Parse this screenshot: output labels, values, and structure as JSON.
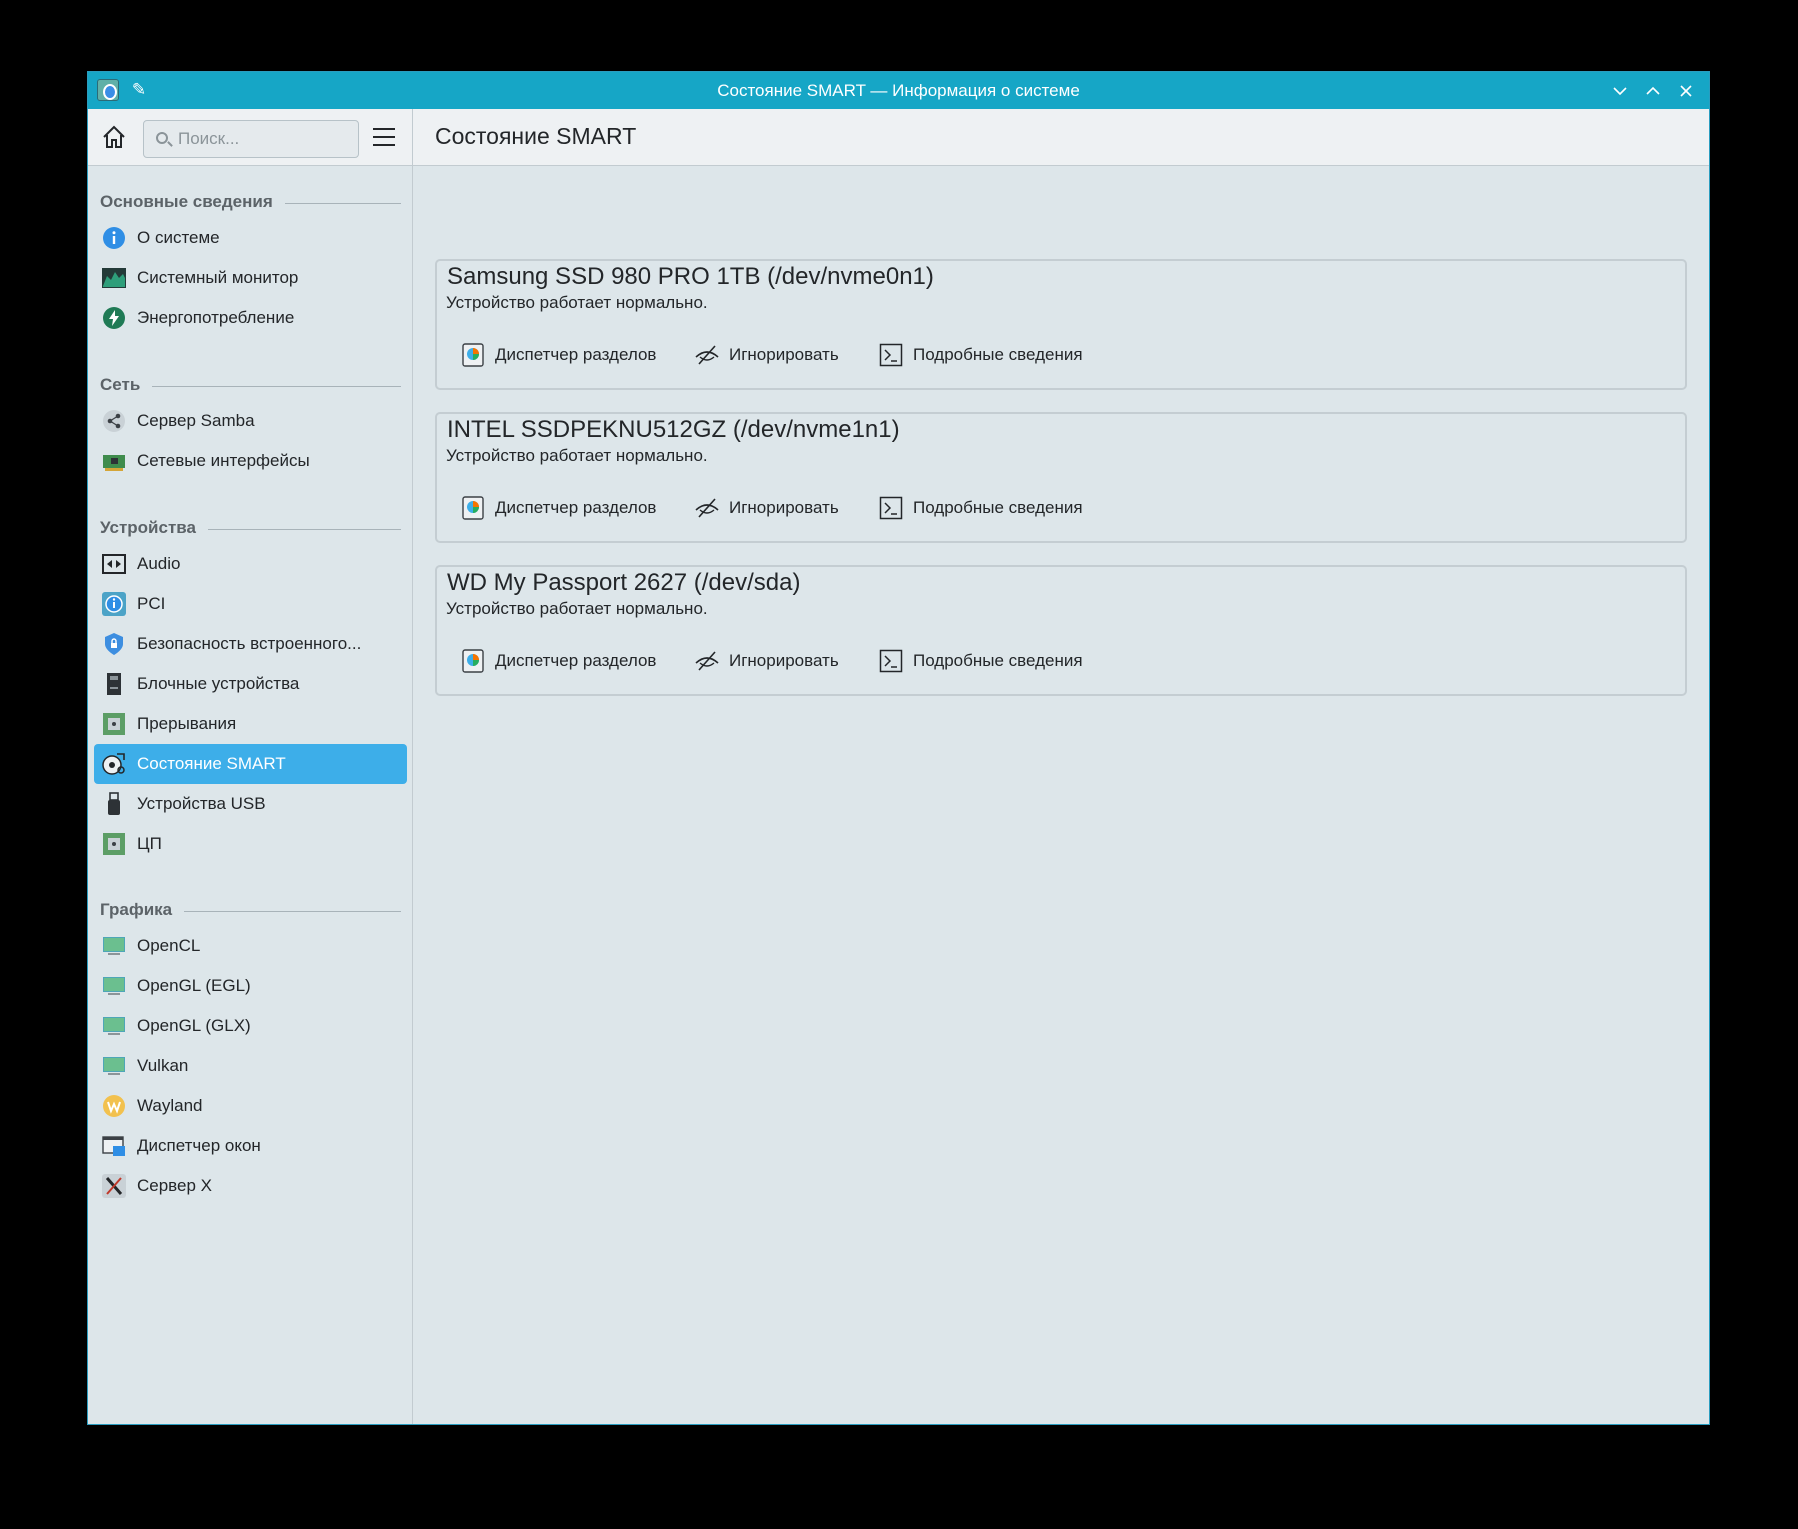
{
  "window": {
    "title": "Состояние SMART — Информация о системе"
  },
  "toolbar": {
    "search_placeholder": "Поиск...",
    "page_title": "Состояние SMART"
  },
  "sidebar": {
    "sections": [
      {
        "label": "Основные сведения"
      },
      {
        "label": "Сеть"
      },
      {
        "label": "Устройства"
      },
      {
        "label": "Графика"
      }
    ],
    "items": [
      {
        "label": "О системе",
        "icon": "info-icon"
      },
      {
        "label": "Системный монитор",
        "icon": "system-monitor-icon"
      },
      {
        "label": "Энергопотребление",
        "icon": "energy-icon"
      },
      {
        "label": "Сервер Samba",
        "icon": "samba-icon"
      },
      {
        "label": "Сетевые интерфейсы",
        "icon": "network-card-icon"
      },
      {
        "label": "Audio",
        "icon": "audio-icon"
      },
      {
        "label": "PCI",
        "icon": "pci-icon"
      },
      {
        "label": "Безопасность встроенного...",
        "icon": "firmware-security-icon"
      },
      {
        "label": "Блочные устройства",
        "icon": "block-device-icon"
      },
      {
        "label": "Прерывания",
        "icon": "interrupts-icon"
      },
      {
        "label": "Состояние SMART",
        "icon": "smart-status-icon",
        "active": true
      },
      {
        "label": "Устройства USB",
        "icon": "usb-icon"
      },
      {
        "label": "ЦП",
        "icon": "cpu-icon"
      },
      {
        "label": "OpenCL",
        "icon": "display-icon"
      },
      {
        "label": "OpenGL (EGL)",
        "icon": "display-icon"
      },
      {
        "label": "OpenGL (GLX)",
        "icon": "display-icon"
      },
      {
        "label": "Vulkan",
        "icon": "display-icon"
      },
      {
        "label": "Wayland",
        "icon": "wayland-icon"
      },
      {
        "label": "Диспетчер окон",
        "icon": "window-manager-icon"
      },
      {
        "label": "Сервер X",
        "icon": "x-server-icon"
      }
    ]
  },
  "disks": [
    {
      "name": "Samsung SSD 980 PRO 1TB (/dev/nvme0n1)",
      "status": "Устройство работает нормально."
    },
    {
      "name": "INTEL SSDPEKNU512GZ (/dev/nvme1n1)",
      "status": "Устройство работает нормально."
    },
    {
      "name": "WD My Passport 2627 (/dev/sda)",
      "status": "Устройство работает нормально."
    }
  ],
  "card_actions": {
    "partition_manager": "Диспетчер разделов",
    "ignore": "Игнорировать",
    "details": "Подробные сведения"
  },
  "colors": {
    "titlebar": "#16a6c6",
    "accent": "#3daee9",
    "background": "#dde6ea"
  }
}
